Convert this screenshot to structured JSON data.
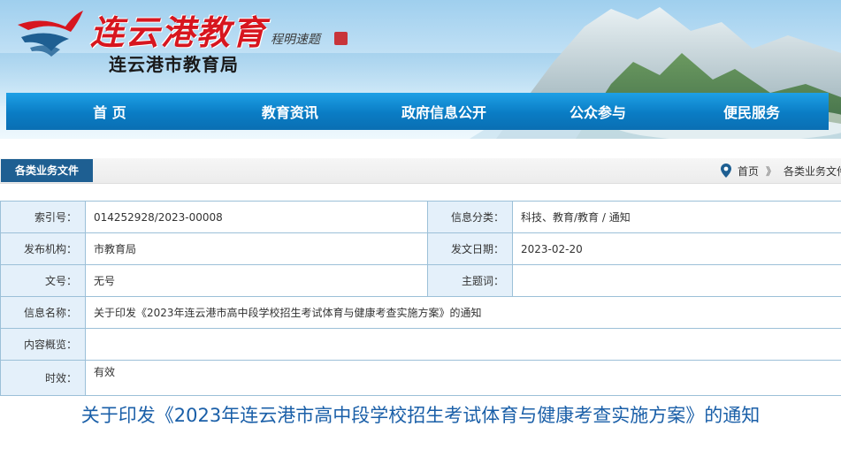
{
  "header": {
    "site_title": "连云港教育",
    "signature": "程明速题",
    "bureau_name": "连云港市教育局",
    "logo_icon": "swallow-logo-icon"
  },
  "nav": {
    "items": [
      {
        "label": "首 页"
      },
      {
        "label": "教育资讯"
      },
      {
        "label": "政府信息公开"
      },
      {
        "label": "公众参与"
      },
      {
        "label": "便民服务"
      }
    ]
  },
  "breadcrumb": {
    "section_tag": "各类业务文件",
    "home": "首页",
    "separator": "》",
    "current": "各类业务文件"
  },
  "info_table": {
    "index_label": "索引号：",
    "index_value": "014252928/2023-00008",
    "category_label": "信息分类：",
    "category_value": "科技、教育/教育 / 通知",
    "publisher_label": "发布机构：",
    "publisher_value": "市教育局",
    "date_label": "发文日期：",
    "date_value": "2023-02-20",
    "doc_no_label": "文号：",
    "doc_no_value": "无号",
    "subject_label": "主题词：",
    "subject_value": "",
    "name_label": "信息名称：",
    "name_value": "关于印发《2023年连云港市高中段学校招生考试体育与健康考查实施方案》的通知",
    "summary_label": "内容概览：",
    "summary_value": "",
    "validity_label": "时效：",
    "validity_value": "有效"
  },
  "article": {
    "title": "关于印发《2023年连云港市高中段学校招生考试体育与健康考查实施方案》的通知"
  },
  "colors": {
    "nav_blue": "#0a7cc4",
    "tag_blue": "#1e5f92",
    "title_red": "#d7161f",
    "label_bg": "#e4f0fa",
    "border": "#9cc0d8",
    "article_title": "#1a5fa8"
  }
}
